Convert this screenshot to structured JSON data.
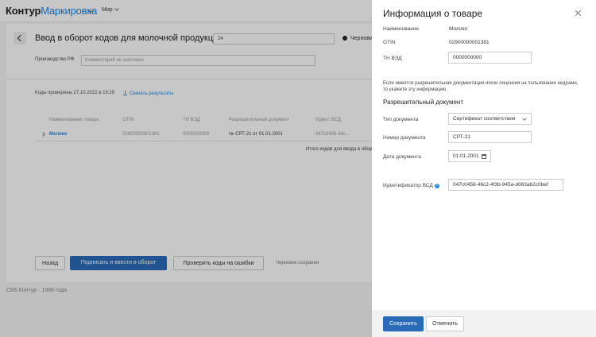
{
  "app": {
    "brand_part1": "Контур",
    "brand_part2": "Маркировка",
    "top_menu": "Мир"
  },
  "page": {
    "title": "Ввод в оборот кодов для молочной продукции",
    "quantity": "24",
    "radio_label": "Черновик",
    "producer_label": "Производство РФ",
    "producer_placeholder": "Комментарий не заполнен",
    "codes_checked": "Коды проверены 27.10.2022 в 19:29",
    "download_link": "Скачать результаты",
    "table": {
      "headers": [
        "Наименование товара",
        "GTIN",
        "ТН ВЭД",
        "Разрешительный документ",
        "Идент. ВСД"
      ],
      "row": {
        "name": "Молоко",
        "gtin": "02900000001381",
        "tnved": "0000000000",
        "doc": "№ СРТ-21 от 01.01.2001",
        "vsd": "047c0458-46c..."
      }
    },
    "total_text": "Итого кодов для ввода в оборот:",
    "back_button": "Назад",
    "sign_button": "Подписать и ввести в оборот",
    "check_button": "Проверить коды на ошибки",
    "saved_text": "Черновик сохранен",
    "footer": "СКБ Контур · 1988 года"
  },
  "panel": {
    "title": "Информация о товаре",
    "name_label": "Наименование",
    "name_value": "Молоко",
    "gtin_label": "GTIN",
    "gtin_value": "02900000001381",
    "tnved_label": "ТН ВЭД",
    "tnved_value": "0000000000",
    "note": "Если имеется разрешительная документация и/или лицензия на пользование недрами, то укажите эту информацию.",
    "section_title": "Разрешительный документ",
    "doc_type_label": "Тип документа",
    "doc_type_value": "Сертификат соответствия",
    "doc_number_label": "Номер документа",
    "doc_number_value": "СРТ-21",
    "doc_date_label": "Дата документа",
    "doc_date_value": "01.01.2001",
    "vsd_label": "Идентификатор ВСД",
    "vsd_value": "047c0458-46c2-4f3b-945a-d063ab2c0bef",
    "save_button": "Сохранить",
    "cancel_button": "Отменить"
  }
}
